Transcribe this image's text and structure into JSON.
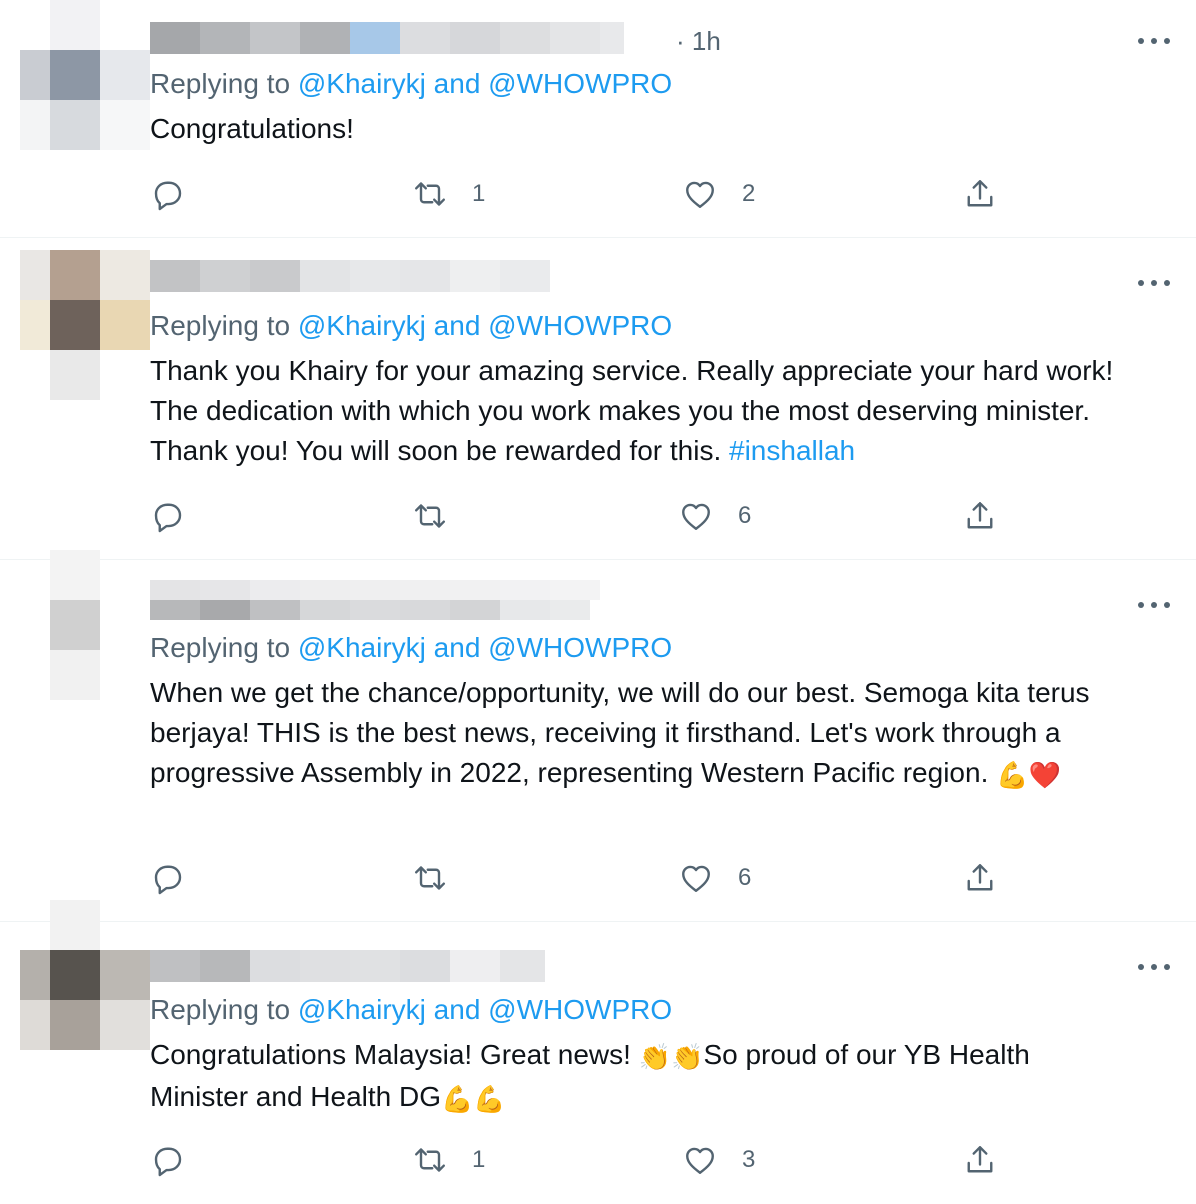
{
  "colors": {
    "accent": "#1d9bf0",
    "secondary_text": "#536471",
    "text": "#0f1419",
    "divider": "#eff3f4"
  },
  "icons": {
    "reply": "reply-icon",
    "retweet": "retweet-icon",
    "like": "heart-icon",
    "share": "share-icon",
    "more": "more-icon"
  },
  "tweets": [
    {
      "time": "· 1h",
      "replying_prefix": "Replying to",
      "mention1": "@Khairykj",
      "and": "and",
      "mention2": "@WHOWPRO",
      "text": "Congratulations!",
      "retweets": "1",
      "likes": "2"
    },
    {
      "replying_prefix": "Replying to",
      "mention1": "@Khairykj",
      "and": "and",
      "mention2": "@WHOWPRO",
      "text": "Thank you Khairy for your amazing service. Really appreciate your hard work! The dedication with which you work makes you the most deserving minister. Thank you! You will soon be rewarded for this. ",
      "hashtag": "#inshallah",
      "retweets": "",
      "likes": "6"
    },
    {
      "replying_prefix": "Replying to",
      "mention1": "@Khairykj",
      "and": "and",
      "mention2": "@WHOWPRO",
      "text": "When we get the chance/opportunity, we will do our best. Semoga kita terus berjaya! THIS is the best news, receiving it firsthand. Let's work through a progressive Assembly in 2022, representing Western Pacific region. ",
      "emoji": "💪❤️",
      "retweets": "",
      "likes": "6"
    },
    {
      "replying_prefix": "Replying to",
      "mention1": "@Khairykj",
      "and": "and",
      "mention2": "@WHOWPRO",
      "text_part1": "Congratulations Malaysia! Great news!  ",
      "emoji1": "👏👏",
      "text_part2": "So proud of our YB Health Minister and Health DG",
      "emoji2": "💪💪",
      "retweets": "1",
      "likes": "3"
    }
  ]
}
